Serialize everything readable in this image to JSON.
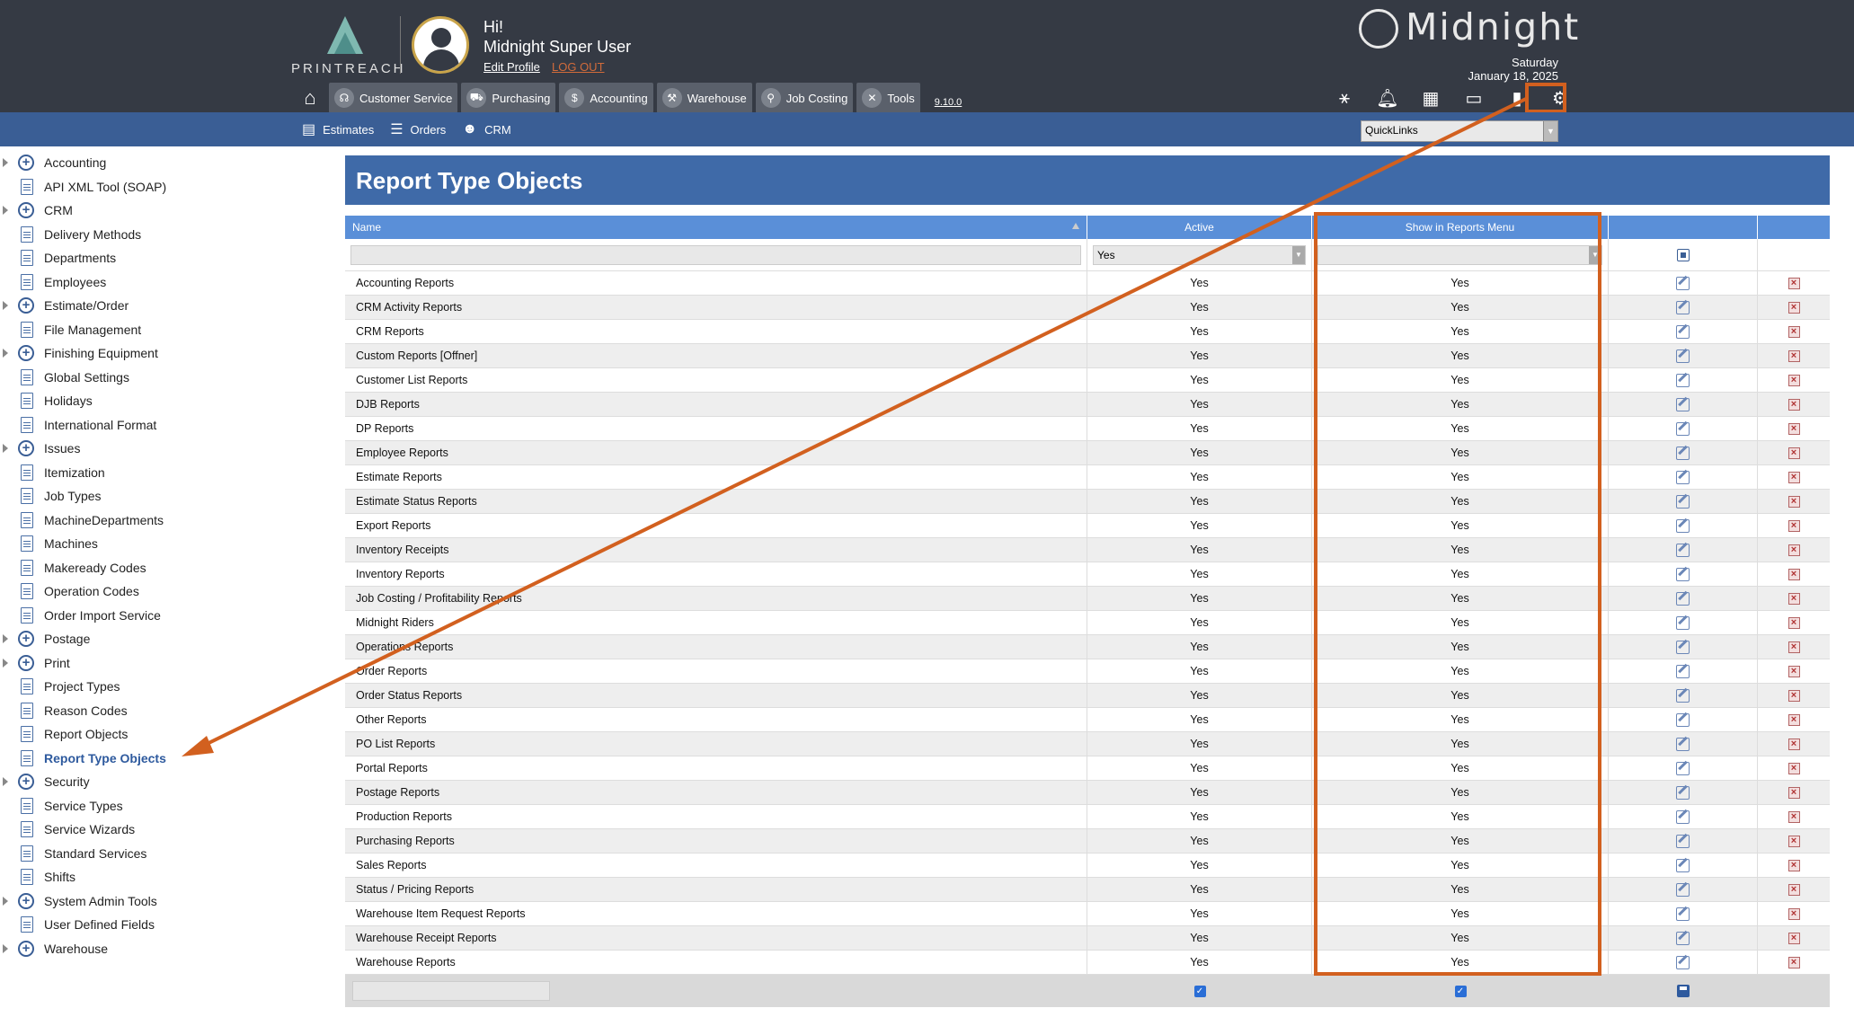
{
  "header": {
    "logo_text": "PRINTREACH",
    "greeting": "Hi!",
    "username": "Midnight Super User",
    "edit_profile": "Edit Profile",
    "logout": "LOG OUT",
    "brand": "Midnight",
    "date_day": "Saturday",
    "date_full": "January 18, 2025",
    "version": "9.10.0",
    "nav": [
      {
        "label": "Customer Service",
        "icon": "headset-icon"
      },
      {
        "label": "Purchasing",
        "icon": "cart-icon"
      },
      {
        "label": "Accounting",
        "icon": "dollar-icon"
      },
      {
        "label": "Warehouse",
        "icon": "forklift-icon"
      },
      {
        "label": "Job Costing",
        "icon": "search-icon"
      },
      {
        "label": "Tools",
        "icon": "tools-icon"
      }
    ],
    "tool_icons": [
      "network-icon",
      "bell-icon",
      "calendar-icon",
      "monitor-icon",
      "document-icon",
      "gear-icon"
    ]
  },
  "subnav": {
    "items": [
      {
        "label": "Estimates",
        "icon": "calculator-icon"
      },
      {
        "label": "Orders",
        "icon": "list-icon"
      },
      {
        "label": "CRM",
        "icon": "users-icon"
      }
    ],
    "quicklinks": "QuickLinks"
  },
  "sidebar": {
    "items": [
      {
        "label": "Accounting",
        "type": "folder"
      },
      {
        "label": "API XML Tool (SOAP)",
        "type": "doc"
      },
      {
        "label": "CRM",
        "type": "folder"
      },
      {
        "label": "Delivery Methods",
        "type": "doc"
      },
      {
        "label": "Departments",
        "type": "doc"
      },
      {
        "label": "Employees",
        "type": "doc"
      },
      {
        "label": "Estimate/Order",
        "type": "folder"
      },
      {
        "label": "File Management",
        "type": "doc"
      },
      {
        "label": "Finishing Equipment",
        "type": "folder"
      },
      {
        "label": "Global Settings",
        "type": "doc"
      },
      {
        "label": "Holidays",
        "type": "doc"
      },
      {
        "label": "International Format",
        "type": "doc"
      },
      {
        "label": "Issues",
        "type": "folder"
      },
      {
        "label": "Itemization",
        "type": "doc"
      },
      {
        "label": "Job Types",
        "type": "doc"
      },
      {
        "label": "MachineDepartments",
        "type": "doc"
      },
      {
        "label": "Machines",
        "type": "doc"
      },
      {
        "label": "Makeready Codes",
        "type": "doc"
      },
      {
        "label": "Operation Codes",
        "type": "doc"
      },
      {
        "label": "Order Import Service",
        "type": "doc"
      },
      {
        "label": "Postage",
        "type": "folder"
      },
      {
        "label": "Print",
        "type": "folder"
      },
      {
        "label": "Project Types",
        "type": "doc"
      },
      {
        "label": "Reason Codes",
        "type": "doc"
      },
      {
        "label": "Report Objects",
        "type": "doc"
      },
      {
        "label": "Report Type Objects",
        "type": "doc",
        "active": true
      },
      {
        "label": "Security",
        "type": "folder"
      },
      {
        "label": "Service Types",
        "type": "doc"
      },
      {
        "label": "Service Wizards",
        "type": "doc"
      },
      {
        "label": "Standard Services",
        "type": "doc"
      },
      {
        "label": "Shifts",
        "type": "doc"
      },
      {
        "label": "System Admin Tools",
        "type": "folder"
      },
      {
        "label": "User Defined Fields",
        "type": "doc"
      },
      {
        "label": "Warehouse",
        "type": "folder"
      }
    ]
  },
  "main": {
    "title": "Report Type Objects",
    "columns": {
      "name": "Name",
      "active": "Active",
      "menu": "Show in Reports Menu"
    },
    "filter": {
      "name": "",
      "active": "Yes",
      "menu": ""
    },
    "rows": [
      {
        "name": "Accounting Reports",
        "active": "Yes",
        "menu": "Yes"
      },
      {
        "name": "CRM Activity Reports",
        "active": "Yes",
        "menu": "Yes"
      },
      {
        "name": "CRM Reports",
        "active": "Yes",
        "menu": "Yes"
      },
      {
        "name": "Custom Reports [Offner]",
        "active": "Yes",
        "menu": "Yes"
      },
      {
        "name": "Customer List Reports",
        "active": "Yes",
        "menu": "Yes"
      },
      {
        "name": "DJB Reports",
        "active": "Yes",
        "menu": "Yes"
      },
      {
        "name": "DP Reports",
        "active": "Yes",
        "menu": "Yes"
      },
      {
        "name": "Employee Reports",
        "active": "Yes",
        "menu": "Yes"
      },
      {
        "name": "Estimate Reports",
        "active": "Yes",
        "menu": "Yes"
      },
      {
        "name": "Estimate Status Reports",
        "active": "Yes",
        "menu": "Yes"
      },
      {
        "name": "Export Reports",
        "active": "Yes",
        "menu": "Yes"
      },
      {
        "name": "Inventory Receipts",
        "active": "Yes",
        "menu": "Yes"
      },
      {
        "name": "Inventory Reports",
        "active": "Yes",
        "menu": "Yes"
      },
      {
        "name": "Job Costing / Profitability Reports",
        "active": "Yes",
        "menu": "Yes"
      },
      {
        "name": "Midnight Riders",
        "active": "Yes",
        "menu": "Yes"
      },
      {
        "name": "Operations Reports",
        "active": "Yes",
        "menu": "Yes"
      },
      {
        "name": "Order Reports",
        "active": "Yes",
        "menu": "Yes"
      },
      {
        "name": "Order Status Reports",
        "active": "Yes",
        "menu": "Yes"
      },
      {
        "name": "Other Reports",
        "active": "Yes",
        "menu": "Yes"
      },
      {
        "name": "PO List Reports",
        "active": "Yes",
        "menu": "Yes"
      },
      {
        "name": "Portal Reports",
        "active": "Yes",
        "menu": "Yes"
      },
      {
        "name": "Postage Reports",
        "active": "Yes",
        "menu": "Yes"
      },
      {
        "name": "Production Reports",
        "active": "Yes",
        "menu": "Yes"
      },
      {
        "name": "Purchasing Reports",
        "active": "Yes",
        "menu": "Yes"
      },
      {
        "name": "Sales Reports",
        "active": "Yes",
        "menu": "Yes"
      },
      {
        "name": "Status / Pricing Reports",
        "active": "Yes",
        "menu": "Yes"
      },
      {
        "name": "Warehouse Item Request Reports",
        "active": "Yes",
        "menu": "Yes"
      },
      {
        "name": "Warehouse Receipt Reports",
        "active": "Yes",
        "menu": "Yes"
      },
      {
        "name": "Warehouse Reports",
        "active": "Yes",
        "menu": "Yes"
      }
    ]
  },
  "colors": {
    "topbar": "#353a44",
    "subnav": "#3a5e95",
    "title_bar": "#3f6aa8",
    "grid_header": "#5a8fd8",
    "annotation": "#d2601f"
  }
}
